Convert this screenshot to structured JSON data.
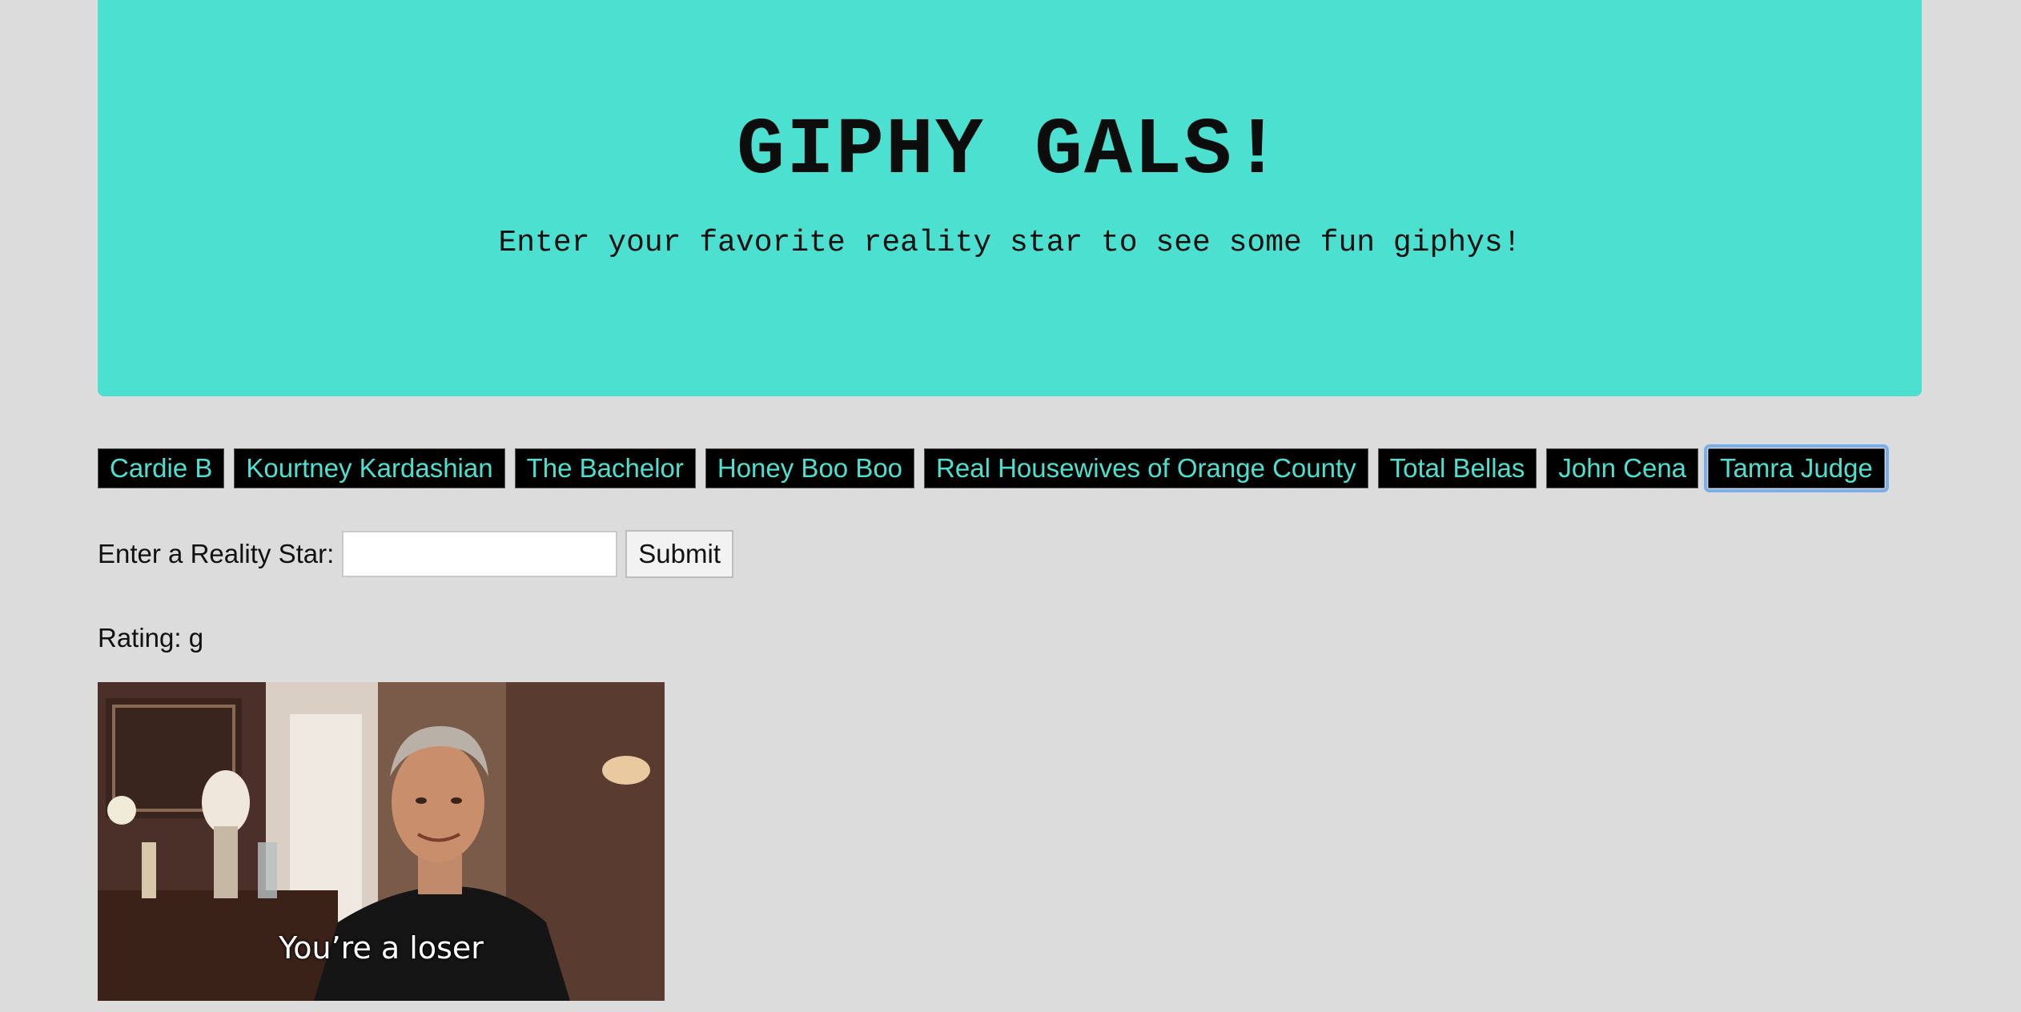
{
  "header": {
    "title": "GIPHY GALS!",
    "subtitle": "Enter your favorite reality star to see some fun giphys!"
  },
  "buttons": [
    "Cardie B",
    "Kourtney Kardashian",
    "The Bachelor",
    "Honey Boo Boo",
    "Real Housewives of Orange County",
    "Total Bellas",
    "John Cena",
    "Tamra Judge"
  ],
  "form": {
    "label": "Enter a Reality Star:",
    "input_value": "",
    "submit_label": "Submit"
  },
  "results": [
    {
      "rating_label": "Rating: g",
      "caption": "You’re a loser"
    }
  ],
  "colors": {
    "accent": "#4ce0d0",
    "background": "#dcdcdc",
    "button_bg": "#000000",
    "focus_ring": "#7aaeea"
  }
}
